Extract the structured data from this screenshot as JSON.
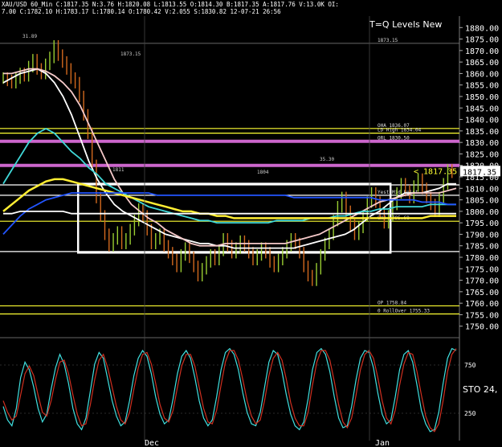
{
  "header": {
    "text": "XAU/USD  60_Min C:1817.35 N:3.76 H:1820.08 L:1813.55 O:1814.30 B:1817.35 A:1817.76 V:13.0K OI:",
    "text2": "7.00 C:1782.10 H:1783.17 L:1780.14 O:1780.42 V:2.055 S:1830.82 12-07-21 26:56"
  },
  "chart_data": [
    {
      "type": "line",
      "title": "T=Q Levels New",
      "xlabel": "",
      "ylabel": "",
      "ylim": [
        1745,
        1885
      ],
      "x_tick_labels": [
        "Dec",
        "Jan"
      ],
      "y_ticks": [
        1750,
        1755,
        1760,
        1765,
        1770,
        1775,
        1780,
        1785,
        1790,
        1795,
        1800,
        1805,
        1810,
        1815,
        1820,
        1825,
        1830,
        1835,
        1840,
        1845,
        1850,
        1855,
        1860,
        1865,
        1870,
        1875,
        1880
      ],
      "last_price": 1817.35,
      "last_price_label": "< 1817.35",
      "grid": false,
      "series": [
        {
          "color": "#ffffff",
          "values": [
            1856,
            1858,
            1860,
            1861,
            1862,
            1860,
            1856,
            1850,
            1842,
            1832,
            1822,
            1814,
            1808,
            1803,
            1800,
            1798,
            1796,
            1794,
            1792,
            1790,
            1789,
            1788,
            1787,
            1786,
            1786,
            1785,
            1785,
            1784,
            1784,
            1784,
            1784,
            1784,
            1784,
            1784,
            1784,
            1785,
            1786,
            1787,
            1788,
            1789,
            1790,
            1792,
            1795,
            1798,
            1800,
            1803,
            1806,
            1808,
            1808,
            1808,
            1809,
            1810,
            1812,
            1812
          ]
        },
        {
          "color": "#f5c9c9",
          "values": [
            1860,
            1860,
            1861,
            1862,
            1862,
            1861,
            1859,
            1856,
            1852,
            1846,
            1838,
            1830,
            1822,
            1814,
            1808,
            1803,
            1800,
            1797,
            1795,
            1792,
            1790,
            1788,
            1786,
            1785,
            1785,
            1785,
            1786,
            1786,
            1786,
            1786,
            1786,
            1786,
            1786,
            1786,
            1787,
            1788,
            1789,
            1790,
            1792,
            1794,
            1796,
            1798,
            1800,
            1802,
            1804,
            1805,
            1806,
            1807,
            1808,
            1808,
            1808,
            1808,
            1809,
            1810
          ]
        },
        {
          "color": "#40d8d8",
          "values": [
            1812,
            1818,
            1824,
            1830,
            1834,
            1836,
            1834,
            1830,
            1826,
            1823,
            1819,
            1816,
            1812,
            1810,
            1808,
            1806,
            1804,
            1802,
            1801,
            1800,
            1799,
            1798,
            1797,
            1796,
            1796,
            1795,
            1795,
            1795,
            1795,
            1795,
            1795,
            1795,
            1796,
            1796,
            1796,
            1796,
            1797,
            1797,
            1797,
            1798,
            1798,
            1799,
            1800,
            1800,
            1801,
            1801,
            1802,
            1802,
            1802,
            1802,
            1803,
            1803,
            1803,
            1803
          ]
        },
        {
          "color": "#ffee33",
          "values": [
            1800,
            1803,
            1806,
            1809,
            1811,
            1813,
            1814,
            1814,
            1813,
            1812,
            1811,
            1810,
            1809,
            1808,
            1807,
            1806,
            1805,
            1804,
            1803,
            1802,
            1801,
            1800,
            1800,
            1799,
            1799,
            1798,
            1798,
            1797,
            1797,
            1797,
            1797,
            1797,
            1797,
            1797,
            1797,
            1797,
            1797,
            1797,
            1797,
            1797,
            1797,
            1797,
            1797,
            1797,
            1797,
            1797,
            1797,
            1797,
            1797,
            1797,
            1798,
            1798,
            1798,
            1798
          ]
        },
        {
          "color": "#2255ff",
          "values": [
            1790,
            1794,
            1798,
            1801,
            1803,
            1805,
            1806,
            1807,
            1808,
            1808,
            1808,
            1808,
            1808,
            1808,
            1808,
            1808,
            1808,
            1808,
            1807,
            1807,
            1807,
            1807,
            1807,
            1807,
            1807,
            1807,
            1807,
            1807,
            1807,
            1807,
            1807,
            1807,
            1807,
            1807,
            1806,
            1806,
            1806,
            1806,
            1806,
            1806,
            1806,
            1806,
            1806,
            1806,
            1805,
            1805,
            1805,
            1805,
            1805,
            1804,
            1804,
            1804,
            1803,
            1803
          ]
        },
        {
          "color": "#ffffff",
          "values": [
            1799,
            1799,
            1800,
            1800,
            1800,
            1800,
            1800,
            1800,
            1799,
            1799,
            1799,
            1799,
            1799,
            1799,
            1799,
            1799,
            1799,
            1799,
            1799,
            1799,
            1799,
            1799,
            1799,
            1799,
            1799,
            1799,
            1799,
            1799,
            1799,
            1799,
            1799,
            1799,
            1799,
            1799,
            1799,
            1799,
            1799,
            1799,
            1799,
            1799,
            1799,
            1799,
            1799,
            1799,
            1799,
            1799,
            1799,
            1799,
            1799,
            1799,
            1799,
            1799,
            1799,
            1799
          ]
        }
      ],
      "price_close": [
        1858,
        1857,
        1856,
        1858,
        1860,
        1859,
        1863,
        1866,
        1862,
        1860,
        1864,
        1867,
        1872,
        1868,
        1865,
        1862,
        1858,
        1856,
        1850,
        1842,
        1834,
        1820,
        1806,
        1798,
        1790,
        1785,
        1788,
        1791,
        1786,
        1788,
        1792,
        1796,
        1801,
        1798,
        1792,
        1786,
        1788,
        1790,
        1785,
        1782,
        1779,
        1776,
        1781,
        1784,
        1780,
        1776,
        1772,
        1775,
        1778,
        1781,
        1779,
        1783,
        1788,
        1785,
        1782,
        1784,
        1787,
        1785,
        1782,
        1779,
        1781,
        1784,
        1782,
        1778,
        1776,
        1779,
        1782,
        1785,
        1788,
        1786,
        1782,
        1776,
        1772,
        1770,
        1775,
        1781,
        1786,
        1790,
        1796,
        1802,
        1806,
        1800,
        1794,
        1790,
        1793,
        1798,
        1804,
        1808,
        1804,
        1799,
        1795,
        1798,
        1803,
        1808,
        1812,
        1809,
        1806,
        1811,
        1814,
        1810,
        1806,
        1803,
        1800,
        1806,
        1812,
        1818,
        1817
      ],
      "levels": [
        {
          "value": 1836.07,
          "color": "#ffff33",
          "label": "OHA 1836.07"
        },
        {
          "value": 1834.04,
          "color": "#ffff33",
          "label": "LD High 1834.04"
        },
        {
          "value": 1830.5,
          "color": "#cc66cc",
          "label": "ORL 1830.50"
        },
        {
          "value": 1820.0,
          "color": "#cc66cc",
          "label": ""
        },
        {
          "value": 1811.5,
          "color": "#ffffff",
          "label": ""
        },
        {
          "value": 1807.0,
          "color": "#ffffff",
          "label": "Yest Mid Point"
        },
        {
          "value": 1795.68,
          "color": "#ffff33",
          "label": "OHJ 1795.68"
        },
        {
          "value": 1782.5,
          "color": "#ffffff",
          "label": ""
        },
        {
          "value": 1758.84,
          "color": "#ffff33",
          "label": "OP 1758.84"
        },
        {
          "value": 1755.33,
          "color": "#ffff33",
          "label": "0 RollOver 1755.33"
        },
        {
          "value": 1873.15,
          "color": "#888888",
          "label": "1873.15"
        }
      ],
      "box": {
        "x0": 0.17,
        "x1": 0.85,
        "y_top": 1812,
        "y_bottom": 1782
      },
      "annotations": [
        "1873.15",
        "31.89",
        "35.30",
        "1804",
        "1811"
      ]
    },
    {
      "type": "line",
      "title": "",
      "indicator_label": "STO 24,",
      "y_ticks": [
        250,
        750
      ],
      "ylim": [
        0,
        1000
      ],
      "series": [
        {
          "color": "#40e0e0",
          "values": [
            320,
            180,
            120,
            300,
            620,
            780,
            700,
            520,
            300,
            160,
            240,
            500,
            720,
            860,
            760,
            560,
            300,
            140,
            80,
            200,
            480,
            760,
            880,
            820,
            600,
            380,
            220,
            120,
            160,
            380,
            640,
            820,
            900,
            840,
            660,
            420,
            240,
            140,
            180,
            400,
            660,
            840,
            900,
            820,
            620,
            380,
            200,
            120,
            180,
            420,
            700,
            880,
            920,
            860,
            700,
            460,
            260,
            140,
            120,
            260,
            520,
            780,
            900,
            860,
            680,
            440,
            240,
            120,
            80,
            160,
            400,
            700,
            880,
            920,
            860,
            680,
            420,
            200,
            100,
            120,
            320,
            600,
            820,
            900,
            880,
            720,
            460,
            240,
            140,
            180,
            420,
            700,
            860,
            900,
            780,
            540,
            280,
            140,
            60,
            80,
            260,
            560,
            820,
            920,
            900
          ]
        },
        {
          "color": "#d03020",
          "values": [
            380,
            260,
            180,
            220,
            440,
            660,
            740,
            640,
            440,
            260,
            220,
            380,
            600,
            780,
            800,
            660,
            440,
            240,
            120,
            140,
            340,
            600,
            800,
            860,
            720,
            520,
            320,
            180,
            140,
            260,
            500,
            720,
            860,
            880,
            760,
            560,
            340,
            200,
            160,
            280,
            520,
            740,
            860,
            860,
            740,
            520,
            300,
            160,
            140,
            280,
            540,
            780,
            900,
            900,
            800,
            600,
            380,
            220,
            140,
            180,
            380,
            640,
            820,
            880,
            800,
            600,
            360,
            200,
            120,
            120,
            260,
            540,
            780,
            900,
            900,
            800,
            580,
            340,
            160,
            100,
            200,
            440,
            700,
            860,
            900,
            820,
            620,
            380,
            200,
            140,
            280,
            540,
            760,
            880,
            860,
            680,
            440,
            220,
            100,
            60,
            140,
            380,
            680,
            860,
            920
          ]
        }
      ]
    }
  ]
}
